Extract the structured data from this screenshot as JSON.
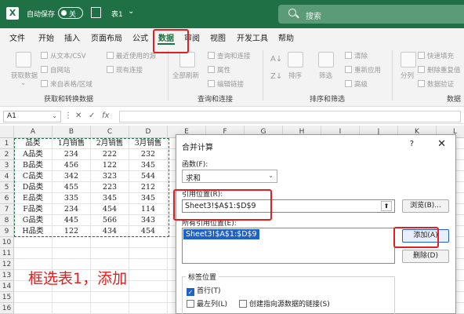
{
  "titlebar": {
    "autosave_label": "自动保存",
    "autosave_state": "关",
    "workbook_name": "表1",
    "search_placeholder": "搜索"
  },
  "menu": [
    "文件",
    "开始",
    "插入",
    "页面布局",
    "公式",
    "数据",
    "审阅",
    "视图",
    "开发工具",
    "帮助"
  ],
  "active_menu": "数据",
  "ribbon": {
    "get_data_label": "获取数据",
    "get_data_items": [
      "从文本/CSV",
      "自网站",
      "来自表格/区域"
    ],
    "recent_items": [
      "最近使用的源",
      "现有连接"
    ],
    "refresh_label": "全部刷新",
    "query_items": [
      "查询和连接",
      "属性",
      "编辑链接"
    ],
    "sort_label": "排序",
    "filter_label": "筛选",
    "filter_items": [
      "清除",
      "重新应用",
      "高级"
    ],
    "split_label": "分列",
    "data_tool_items": [
      "快速填充",
      "删除重复值",
      "数据验证"
    ],
    "group_labels": [
      "获取和转换数据",
      "查询和连接",
      "排序和筛选",
      "数据"
    ]
  },
  "formula_bar": {
    "name_box": "A1",
    "fx_label": "fx"
  },
  "sheet": {
    "columns": [
      "A",
      "B",
      "C",
      "D",
      "E",
      "F",
      "G",
      "H",
      "I",
      "J",
      "K",
      "L"
    ],
    "rows": [
      "1",
      "2",
      "3",
      "4",
      "5",
      "6",
      "7",
      "8",
      "9",
      "10",
      "11",
      "12",
      "13",
      "14",
      "15",
      "16"
    ],
    "data": [
      [
        "品类",
        "1月销售",
        "2月销售",
        "3月销售"
      ],
      [
        "A品类",
        "234",
        "222",
        "232"
      ],
      [
        "B品类",
        "456",
        "122",
        "345"
      ],
      [
        "C品类",
        "342",
        "323",
        "544"
      ],
      [
        "D品类",
        "455",
        "223",
        "212"
      ],
      [
        "E品类",
        "335",
        "345",
        "345"
      ],
      [
        "F品类",
        "234",
        "454",
        "114"
      ],
      [
        "G品类",
        "445",
        "566",
        "343"
      ],
      [
        "H品类",
        "122",
        "434",
        "454"
      ]
    ]
  },
  "annotation": "框选表1，添加",
  "dialog": {
    "title": "合并计算",
    "help": "?",
    "close": "✕",
    "function_label": "函数(F):",
    "function_value": "求和",
    "ref_label": "引用位置(R):",
    "ref_value": "Sheet3!$A$1:$D$9",
    "browse_button": "浏览(B)...",
    "all_refs_label": "所有引用位置(E):",
    "all_refs": [
      "Sheet3!$A$1:$D$9"
    ],
    "add_button": "添加(A)",
    "delete_button": "删除(D)",
    "tag_position_label": "标签位置",
    "first_row_label": "首行(T)",
    "first_row_checked": true,
    "left_col_label": "最左列(L)",
    "left_col_checked": false,
    "link_label": "创建指向源数据的链接(S)",
    "link_checked": false
  },
  "colors": {
    "excel_green": "#1f7145",
    "highlight_red": "#e02020",
    "selection_blue": "#1f62c7"
  }
}
